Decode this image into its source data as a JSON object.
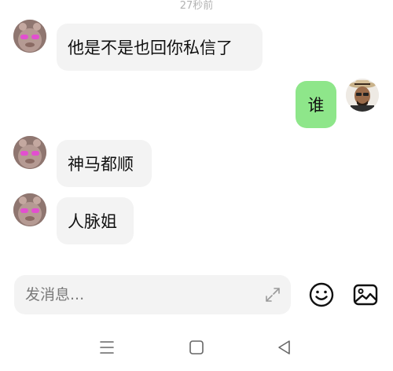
{
  "timestamp": "27秒前",
  "messages": [
    {
      "direction": "in",
      "text": "他是不是也回你私信了"
    },
    {
      "direction": "out",
      "text": "谁"
    },
    {
      "direction": "in",
      "text": "神马都顺"
    },
    {
      "direction": "in",
      "text": "人脉姐"
    }
  ],
  "composer": {
    "placeholder": "发消息..."
  },
  "icons": {
    "expand": "expand-icon",
    "emoji": "emoji-icon",
    "image": "image-icon",
    "nav_menu": "menu-icon",
    "nav_home": "home-icon",
    "nav_back": "back-icon"
  },
  "colors": {
    "incoming_bubble": "#f3f3f3",
    "outgoing_bubble": "#8ee68a",
    "timestamp": "#b3b3b3"
  }
}
